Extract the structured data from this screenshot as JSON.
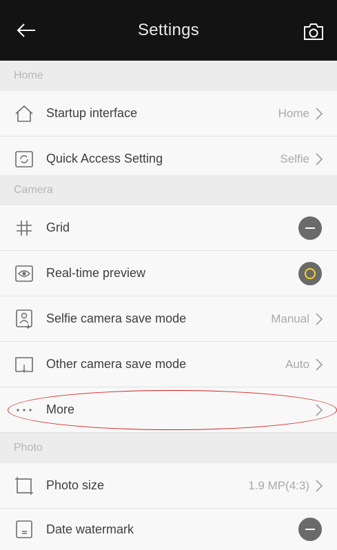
{
  "header": {
    "title": "Settings",
    "back_icon": "arrow-left-icon",
    "camera_icon": "camera-icon"
  },
  "sections": {
    "home": "Home",
    "camera": "Camera",
    "photo": "Photo"
  },
  "rows": {
    "startup": {
      "label": "Startup interface",
      "value": "Home"
    },
    "quick_access": {
      "label": "Quick Access Setting",
      "value": "Selfie"
    },
    "grid": {
      "label": "Grid",
      "state": "off"
    },
    "realtime_preview": {
      "label": "Real-time preview",
      "state": "on"
    },
    "selfie_save": {
      "label": "Selfie camera save mode",
      "value": "Manual"
    },
    "other_save": {
      "label": "Other camera save mode",
      "value": "Auto"
    },
    "more": {
      "label": "More"
    },
    "photo_size": {
      "label": "Photo size",
      "value": "1.9 MP(4:3)"
    },
    "date_watermark": {
      "label": "Date watermark",
      "state": "off"
    }
  },
  "colors": {
    "header_bg": "#131313",
    "toggle_on_ring": "#ffd31a",
    "annotation": "#d71c1c"
  }
}
